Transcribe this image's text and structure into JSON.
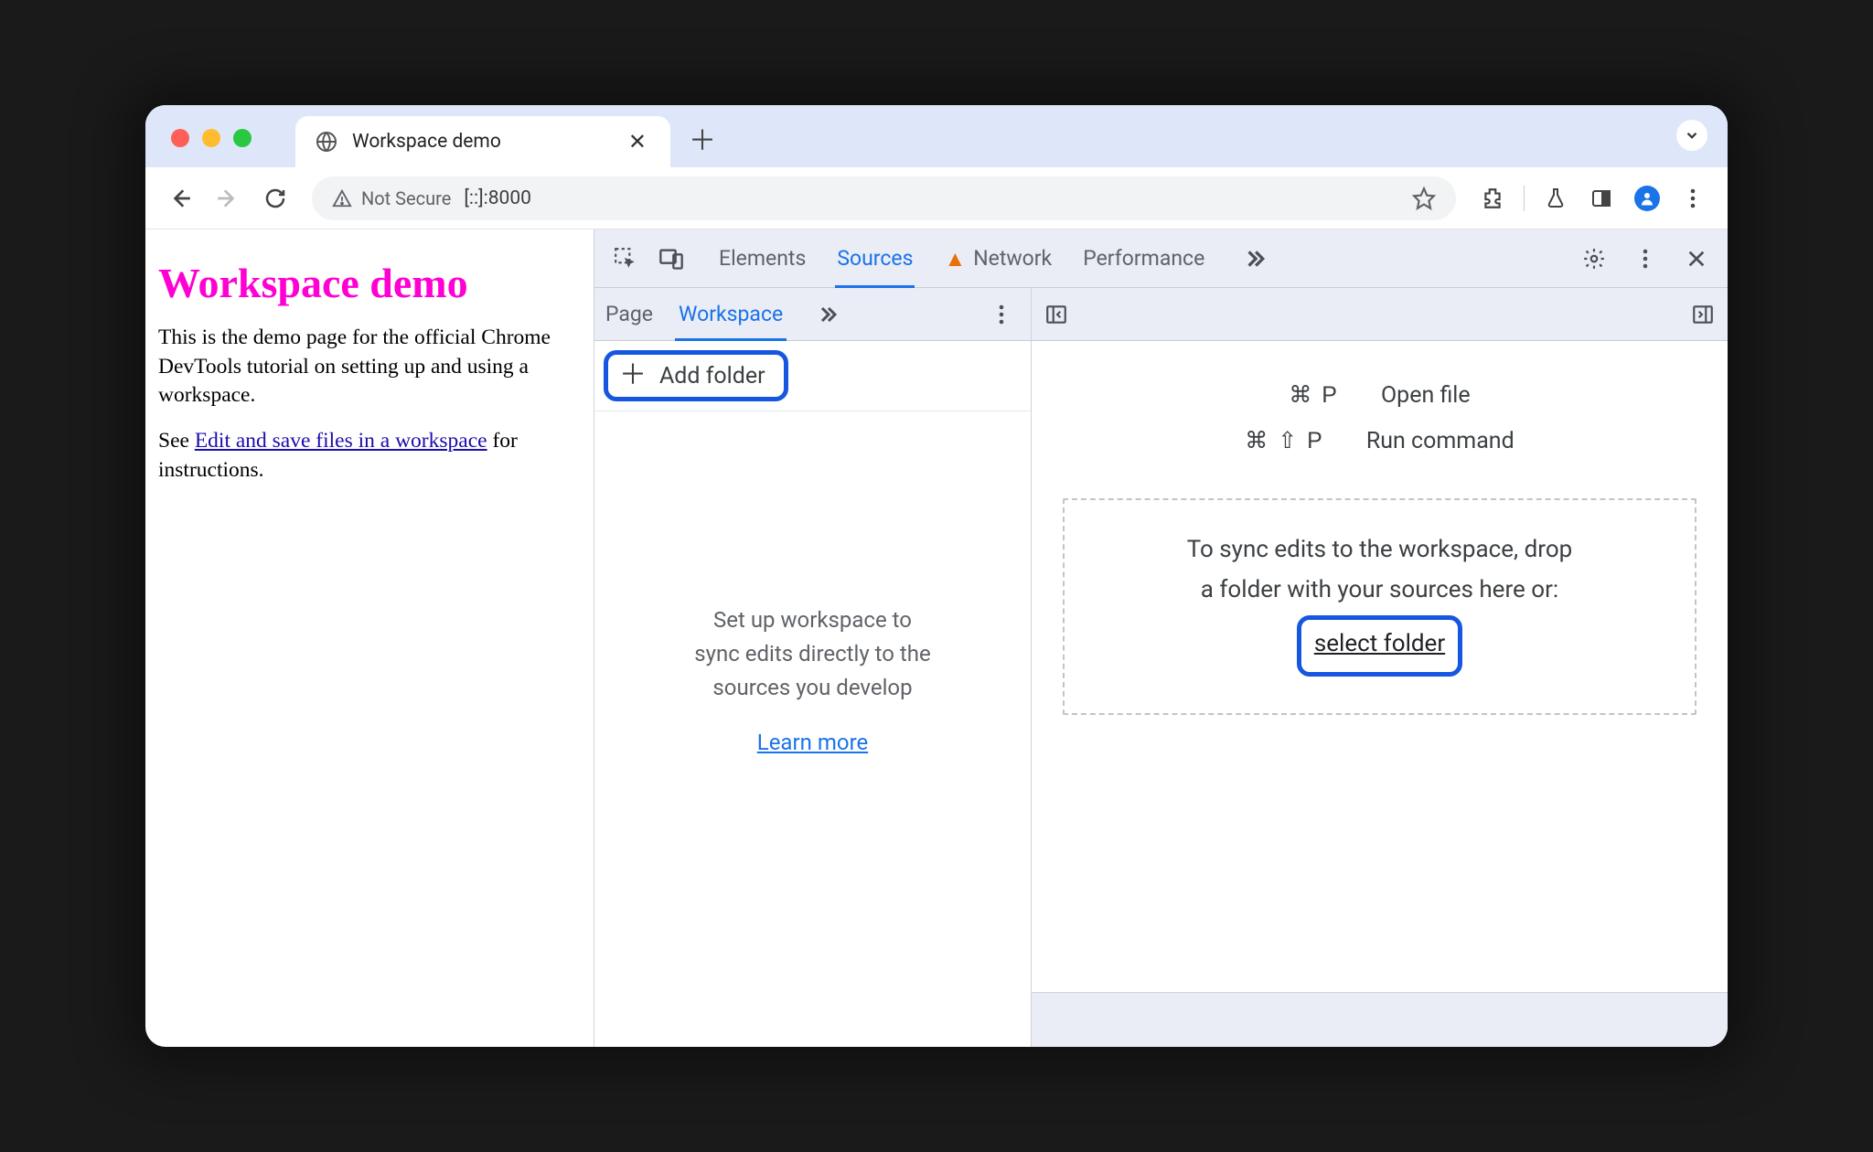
{
  "browser": {
    "tab_title": "Workspace demo",
    "omnibox": {
      "security_label": "Not Secure",
      "url": "[::]:8000"
    }
  },
  "page": {
    "heading": "Workspace demo",
    "para1": "This is the demo page for the official Chrome DevTools tutorial on setting up and using a workspace.",
    "para2_prefix": "See ",
    "para2_link": "Edit and save files in a workspace",
    "para2_suffix": " for instructions."
  },
  "devtools": {
    "top_tabs": {
      "elements": "Elements",
      "sources": "Sources",
      "network": "Network",
      "performance": "Performance"
    },
    "sources": {
      "subtabs": {
        "page": "Page",
        "workspace": "Workspace"
      },
      "add_folder": "Add folder",
      "left_msg_l1": "Set up workspace to",
      "left_msg_l2": "sync edits directly to the",
      "left_msg_l3": "sources you develop",
      "learn_more": "Learn more",
      "shortcuts": {
        "open_file": {
          "keys": "⌘ P",
          "label": "Open file"
        },
        "run_cmd": {
          "keys": "⌘ ⇧ P",
          "label": "Run command"
        }
      },
      "dropzone_l1": "To sync edits to the workspace, drop",
      "dropzone_l2": "a folder with your sources here or:",
      "select_folder": "select folder"
    }
  }
}
